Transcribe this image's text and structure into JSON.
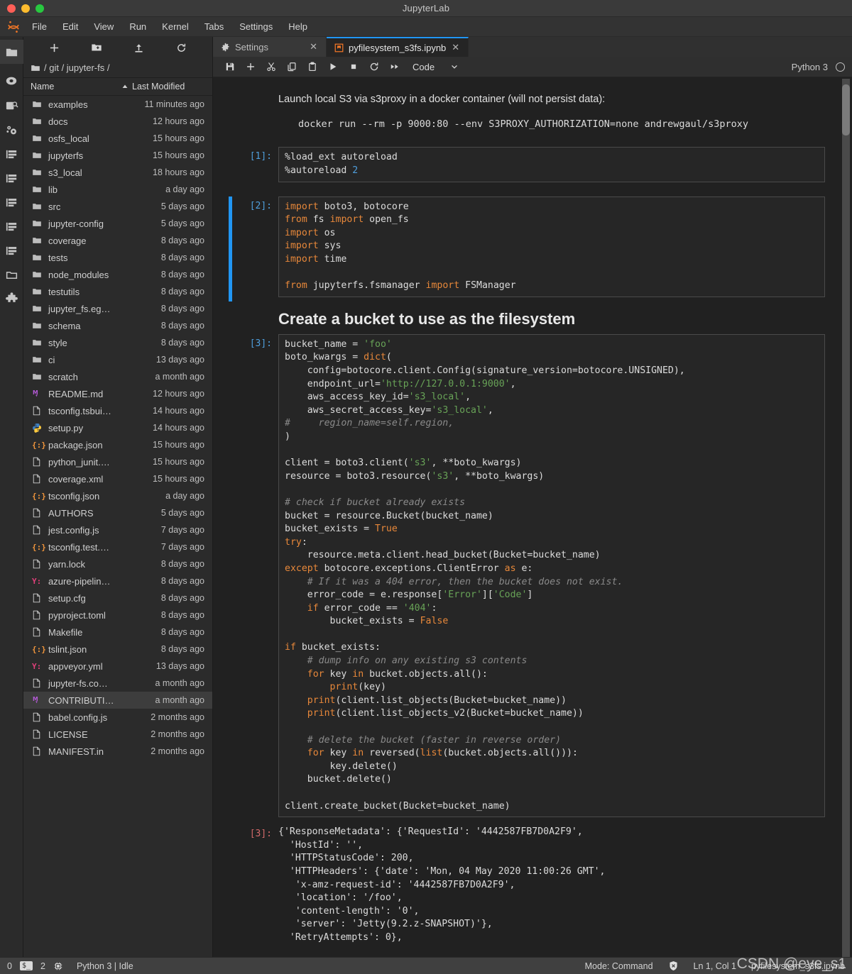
{
  "window": {
    "title": "JupyterLab"
  },
  "menubar": {
    "items": [
      "File",
      "Edit",
      "View",
      "Run",
      "Kernel",
      "Tabs",
      "Settings",
      "Help"
    ]
  },
  "activity_bar": {
    "items": [
      {
        "name": "file-browser",
        "icon": "folder-icon",
        "active": true
      },
      {
        "name": "running-terminals-kernels",
        "icon": "circle-icon",
        "active": false
      },
      {
        "name": "command-palette",
        "icon": "palette-search-icon",
        "active": false
      },
      {
        "name": "property-inspector",
        "icon": "gears-icon",
        "active": false
      },
      {
        "name": "jupyterfs-1",
        "icon": "list-icon",
        "active": false
      },
      {
        "name": "jupyterfs-2",
        "icon": "list-icon",
        "active": false
      },
      {
        "name": "jupyterfs-3",
        "icon": "list-icon",
        "active": false
      },
      {
        "name": "jupyterfs-4",
        "icon": "list-icon",
        "active": false
      },
      {
        "name": "jupyterfs-5",
        "icon": "list-icon",
        "active": false
      },
      {
        "name": "open-tabs",
        "icon": "folder-outline-icon",
        "active": false
      },
      {
        "name": "extension-manager",
        "icon": "puzzle-icon",
        "active": false
      }
    ]
  },
  "file_browser": {
    "toolbar": [
      {
        "name": "new-launcher-button",
        "icon": "plus-icon"
      },
      {
        "name": "new-folder-button",
        "icon": "folder-plus-icon"
      },
      {
        "name": "upload-button",
        "icon": "upload-icon"
      },
      {
        "name": "refresh-button",
        "icon": "refresh-icon"
      }
    ],
    "breadcrumb": "/ git / jupyter-fs /",
    "columns": {
      "name": "Name",
      "last_modified": "Last Modified"
    },
    "sort_direction": "ascending",
    "rows": [
      {
        "name": "examples",
        "modified": "11 minutes ago",
        "type": "folder",
        "selected": false
      },
      {
        "name": "docs",
        "modified": "12 hours ago",
        "type": "folder",
        "selected": false
      },
      {
        "name": "osfs_local",
        "modified": "15 hours ago",
        "type": "folder",
        "selected": false
      },
      {
        "name": "jupyterfs",
        "modified": "15 hours ago",
        "type": "folder",
        "selected": false
      },
      {
        "name": "s3_local",
        "modified": "18 hours ago",
        "type": "folder",
        "selected": false
      },
      {
        "name": "lib",
        "modified": "a day ago",
        "type": "folder",
        "selected": false
      },
      {
        "name": "src",
        "modified": "5 days ago",
        "type": "folder",
        "selected": false
      },
      {
        "name": "jupyter-config",
        "modified": "5 days ago",
        "type": "folder",
        "selected": false
      },
      {
        "name": "coverage",
        "modified": "8 days ago",
        "type": "folder",
        "selected": false
      },
      {
        "name": "tests",
        "modified": "8 days ago",
        "type": "folder",
        "selected": false
      },
      {
        "name": "node_modules",
        "modified": "8 days ago",
        "type": "folder",
        "selected": false
      },
      {
        "name": "testutils",
        "modified": "8 days ago",
        "type": "folder",
        "selected": false
      },
      {
        "name": "jupyter_fs.eg…",
        "modified": "8 days ago",
        "type": "folder",
        "selected": false
      },
      {
        "name": "schema",
        "modified": "8 days ago",
        "type": "folder",
        "selected": false
      },
      {
        "name": "style",
        "modified": "8 days ago",
        "type": "folder",
        "selected": false
      },
      {
        "name": "ci",
        "modified": "13 days ago",
        "type": "folder",
        "selected": false
      },
      {
        "name": "scratch",
        "modified": "a month ago",
        "type": "folder",
        "selected": false
      },
      {
        "name": "README.md",
        "modified": "12 hours ago",
        "type": "markdown",
        "selected": false
      },
      {
        "name": "tsconfig.tsbui…",
        "modified": "14 hours ago",
        "type": "file",
        "selected": false
      },
      {
        "name": "setup.py",
        "modified": "14 hours ago",
        "type": "python",
        "selected": false
      },
      {
        "name": "package.json",
        "modified": "15 hours ago",
        "type": "json",
        "selected": false
      },
      {
        "name": "python_junit.…",
        "modified": "15 hours ago",
        "type": "file",
        "selected": false
      },
      {
        "name": "coverage.xml",
        "modified": "15 hours ago",
        "type": "file",
        "selected": false
      },
      {
        "name": "tsconfig.json",
        "modified": "a day ago",
        "type": "json",
        "selected": false
      },
      {
        "name": "AUTHORS",
        "modified": "5 days ago",
        "type": "file",
        "selected": false
      },
      {
        "name": "jest.config.js",
        "modified": "7 days ago",
        "type": "file",
        "selected": false
      },
      {
        "name": "tsconfig.test.…",
        "modified": "7 days ago",
        "type": "json",
        "selected": false
      },
      {
        "name": "yarn.lock",
        "modified": "8 days ago",
        "type": "file",
        "selected": false
      },
      {
        "name": "azure-pipelin…",
        "modified": "8 days ago",
        "type": "yaml",
        "selected": false
      },
      {
        "name": "setup.cfg",
        "modified": "8 days ago",
        "type": "file",
        "selected": false
      },
      {
        "name": "pyproject.toml",
        "modified": "8 days ago",
        "type": "file",
        "selected": false
      },
      {
        "name": "Makefile",
        "modified": "8 days ago",
        "type": "file",
        "selected": false
      },
      {
        "name": "tslint.json",
        "modified": "8 days ago",
        "type": "json",
        "selected": false
      },
      {
        "name": "appveyor.yml",
        "modified": "13 days ago",
        "type": "yaml",
        "selected": false
      },
      {
        "name": "jupyter-fs.co…",
        "modified": "a month ago",
        "type": "file",
        "selected": false
      },
      {
        "name": "CONTRIBUTI…",
        "modified": "a month ago",
        "type": "markdown",
        "selected": true
      },
      {
        "name": "babel.config.js",
        "modified": "2 months ago",
        "type": "file",
        "selected": false
      },
      {
        "name": "LICENSE",
        "modified": "2 months ago",
        "type": "file",
        "selected": false
      },
      {
        "name": "MANIFEST.in",
        "modified": "2 months ago",
        "type": "file",
        "selected": false
      }
    ]
  },
  "tabs": [
    {
      "label": "Settings",
      "icon": "gear-icon",
      "active": false
    },
    {
      "label": "pyfilesystem_s3fs.ipynb",
      "icon": "notebook-icon",
      "active": true
    }
  ],
  "notebook_toolbar": {
    "buttons": [
      {
        "name": "save-button",
        "icon": "save-icon"
      },
      {
        "name": "insert-cell-button",
        "icon": "plus-icon"
      },
      {
        "name": "cut-cell-button",
        "icon": "scissors-icon"
      },
      {
        "name": "copy-cell-button",
        "icon": "copy-icon"
      },
      {
        "name": "paste-cell-button",
        "icon": "paste-icon"
      },
      {
        "name": "run-cell-button",
        "icon": "play-icon"
      },
      {
        "name": "interrupt-kernel-button",
        "icon": "stop-icon"
      },
      {
        "name": "restart-kernel-button",
        "icon": "restart-icon"
      },
      {
        "name": "restart-run-all-button",
        "icon": "fast-forward-icon"
      }
    ],
    "cell_type": "Code",
    "kernel_name": "Python 3",
    "kernel_status": "idle"
  },
  "notebook": {
    "md_intro": "Launch local S3 via s3proxy in a docker container (will not persist data):",
    "md_code": "docker run --rm -p 9000:80 --env S3PROXY_AUTHORIZATION=none andrewgaul/s3proxy",
    "heading": "Create a bucket to use as the filesystem",
    "cell1_prompt": "[1]:",
    "cell2_prompt": "[2]:",
    "cell3_prompt": "[3]:",
    "out3_prompt": "[3]:",
    "cell1_source": "%load_ext autoreload\n%autoreload 2",
    "cell2_source": "import boto3, botocore\nfrom fs import open_fs\nimport os\nimport sys\nimport time\n\nfrom jupyterfs.fsmanager import FSManager",
    "cell3_source": "bucket_name = 'foo'\nboto_kwargs = dict(\n    config=botocore.client.Config(signature_version=botocore.UNSIGNED),\n    endpoint_url='http://127.0.0.1:9000',\n    aws_access_key_id='s3_local',\n    aws_secret_access_key='s3_local',\n#     region_name=self.region,\n)\n\nclient = boto3.client('s3', **boto_kwargs)\nresource = boto3.resource('s3', **boto_kwargs)\n\n# check if bucket already exists\nbucket = resource.Bucket(bucket_name)\nbucket_exists = True\ntry:\n    resource.meta.client.head_bucket(Bucket=bucket_name)\nexcept botocore.exceptions.ClientError as e:\n    # If it was a 404 error, then the bucket does not exist.\n    error_code = e.response['Error']['Code']\n    if error_code == '404':\n        bucket_exists = False\n\nif bucket_exists:\n    # dump info on any existing s3 contents\n    for key in bucket.objects.all():\n        print(key)\n    print(client.list_objects(Bucket=bucket_name))\n    print(client.list_objects_v2(Bucket=bucket_name))\n\n    # delete the bucket (faster in reverse order)\n    for key in reversed(list(bucket.objects.all())):\n        key.delete()\n    bucket.delete()\n\nclient.create_bucket(Bucket=bucket_name)",
    "out3_text": "{'ResponseMetadata': {'RequestId': '4442587FB7D0A2F9',\n  'HostId': '',\n  'HTTPStatusCode': 200,\n  'HTTPHeaders': {'date': 'Mon, 04 May 2020 11:00:26 GMT',\n   'x-amz-request-id': '4442587FB7D0A2F9',\n   'location': '/foo',\n   'content-length': '0',\n   'server': 'Jetty(9.2.z-SNAPSHOT)'},\n  'RetryAttempts': 0},"
  },
  "status_bar": {
    "kernel_count": "0",
    "terminal_badge": "$_",
    "notebook_count": "2",
    "kernel_status": "Python 3 | Idle",
    "mode": "Mode: Command",
    "cursor": "Ln 1, Col 1",
    "filename": "pyfilesystem_s3fs.ipynb"
  },
  "watermark": "CSDN @eye_s1",
  "colors": {
    "accent_blue": "#2196f3",
    "keyword_orange": "#e8883a",
    "string_green": "#68a357",
    "comment_gray": "#8a8a8a",
    "prompt_blue": "#4f9fdd",
    "bg_dark": "#212121",
    "panel_bg": "#2b2b2b"
  }
}
